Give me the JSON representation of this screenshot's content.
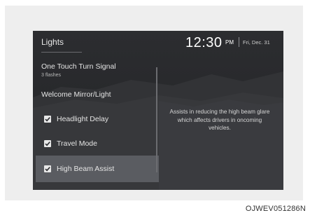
{
  "header": {
    "menu_title": "Lights",
    "clock": "12:30",
    "ampm": "PM",
    "date": "Fri, Dec. 31"
  },
  "menu": {
    "items": [
      {
        "label": "One Touch Turn Signal",
        "sublabel": "3 flashes",
        "has_checkbox": false,
        "checked": false,
        "selected": false
      },
      {
        "label": "Welcome Mirror/Light",
        "has_checkbox": false,
        "checked": false,
        "selected": false
      },
      {
        "label": "Headlight Delay",
        "has_checkbox": true,
        "checked": true,
        "selected": false
      },
      {
        "label": "Travel Mode",
        "has_checkbox": true,
        "checked": true,
        "selected": false
      },
      {
        "label": "High Beam Assist",
        "has_checkbox": true,
        "checked": true,
        "selected": true
      }
    ]
  },
  "help": {
    "text": "Assists in reducing the high beam glare which affects drivers in oncoming vehicles."
  },
  "figure_code": "OJWEV051286N",
  "colors": {
    "screen_bg": "#2a2b2e",
    "selected_bg": "#5a5c61",
    "text": "#e4e4e4",
    "checkbox": "#e8e8e8"
  }
}
